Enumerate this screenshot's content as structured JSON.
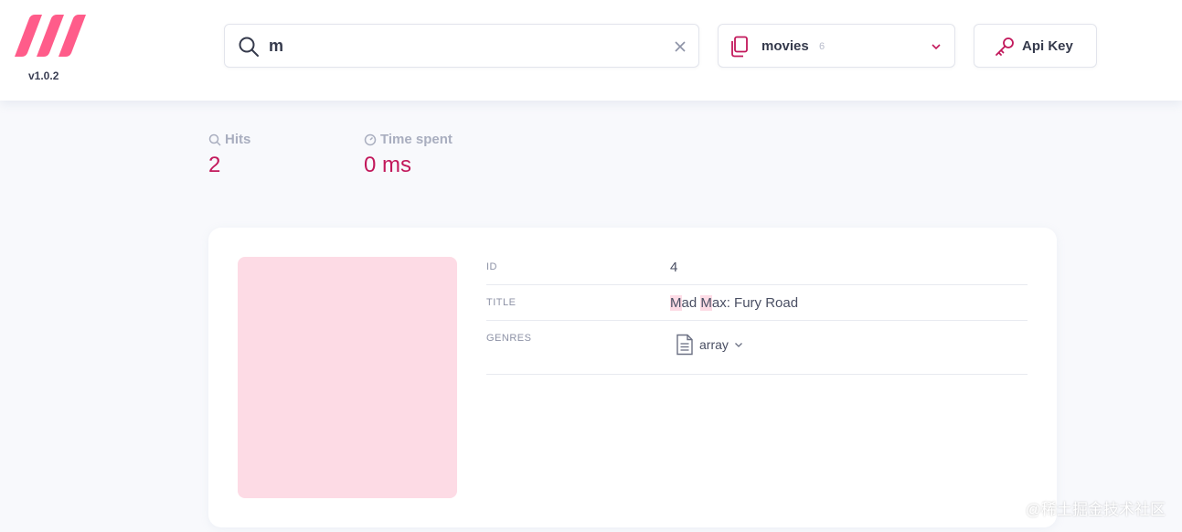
{
  "app": {
    "version": "v1.0.2",
    "brand_color": "#ff4e7c",
    "accent_color": "#c2185b"
  },
  "search": {
    "query": "m",
    "icon": "search-icon",
    "clear_icon": "close-icon"
  },
  "index": {
    "name": "movies",
    "count": "6",
    "icon": "copy-icon"
  },
  "api_key": {
    "label": "Api Key",
    "icon": "key-icon"
  },
  "stats": {
    "hits_label": "Hits",
    "hits_value": "2",
    "time_label": "Time spent",
    "time_value": "0 ms"
  },
  "result": {
    "fields": [
      {
        "key": "ID",
        "value": "4"
      },
      {
        "key": "TITLE",
        "value_parts": [
          {
            "text": "M",
            "highlight": true
          },
          {
            "text": "ad ",
            "highlight": false
          },
          {
            "text": "M",
            "highlight": true
          },
          {
            "text": "ax: Fury Road",
            "highlight": false
          }
        ]
      },
      {
        "key": "GENRES",
        "value": "array"
      }
    ]
  },
  "watermark": "@稀土掘金技术社区"
}
